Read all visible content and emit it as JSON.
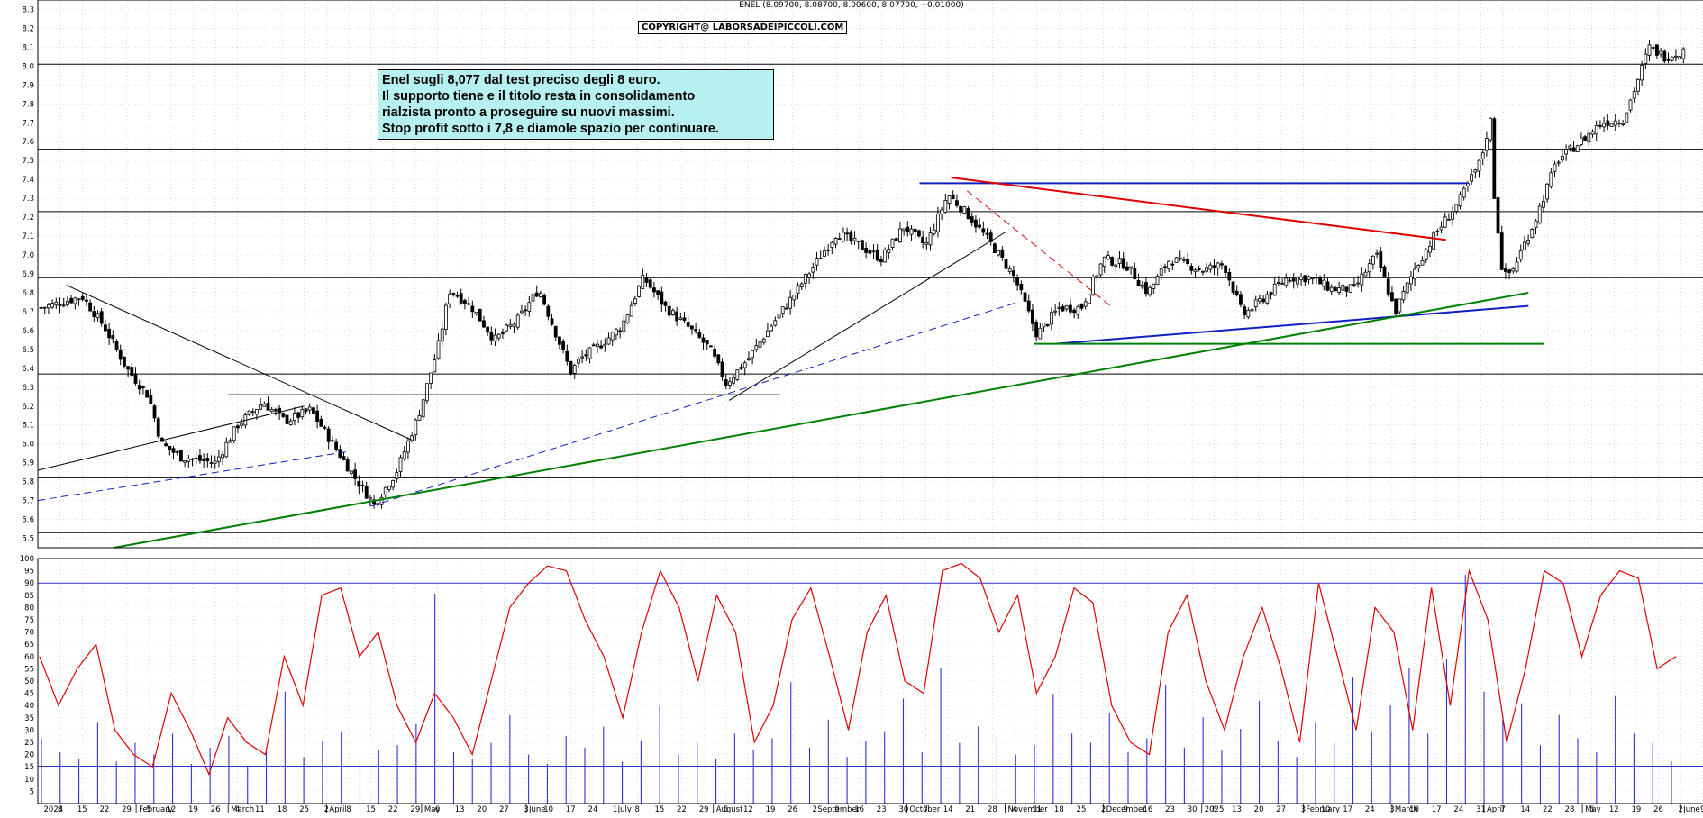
{
  "header": {
    "ohlc": "ENEL (8.09700, 8.08700, 8.00600, 8.07700, +0.01000)",
    "copyright": "COPYRIGHT@ LABORSADEIPICCOLI.COM"
  },
  "annotation": {
    "lines": [
      "Enel sugli 8,077 dal test preciso degli 8 euro.",
      "Il supporto tiene e il titolo resta in consolidamento",
      "rialzista pronto a proseguire su nuovi massimi.",
      "Stop profit sotto i 7,8 e diamole spazio per continuare."
    ]
  },
  "colors": {
    "candle": "#000000",
    "volume": "#3030d8",
    "stochastic": "#e00000",
    "support": "#008000",
    "trend_blue": "#1020c0",
    "resistance": "#e00000",
    "annotation_bg": "#b6f0f0"
  },
  "chart_data": [
    {
      "type": "candlestick",
      "title": "ENEL",
      "ylim": [
        5.45,
        8.35
      ],
      "y_ticks": [
        "5.5",
        "5.6",
        "5.7",
        "5.8",
        "5.9",
        "6.0",
        "6.1",
        "6.2",
        "6.3",
        "6.4",
        "6.5",
        "6.6",
        "6.7",
        "6.8",
        "6.9",
        "7.0",
        "7.1",
        "7.2",
        "7.3",
        "7.4",
        "7.5",
        "7.6",
        "7.7",
        "7.8",
        "7.9",
        "8.0",
        "8.1",
        "8.2",
        "8.3"
      ],
      "horizontal_levels": [
        5.53,
        5.82,
        6.37,
        6.88,
        7.23,
        7.56,
        8.01
      ],
      "close_path": [
        [
          "2024-01-02",
          6.72
        ],
        [
          "2024-01-15",
          6.78
        ],
        [
          "2024-01-22",
          6.62
        ],
        [
          "2024-01-29",
          6.4
        ],
        [
          "2024-02-05",
          6.25
        ],
        [
          "2024-02-09",
          6.0
        ],
        [
          "2024-02-15",
          5.93
        ],
        [
          "2024-02-26",
          5.9
        ],
        [
          "2024-03-04",
          6.1
        ],
        [
          "2024-03-12",
          6.22
        ],
        [
          "2024-03-19",
          6.12
        ],
        [
          "2024-03-27",
          6.18
        ],
        [
          "2024-04-03",
          6.0
        ],
        [
          "2024-04-10",
          5.82
        ],
        [
          "2024-04-16",
          5.68
        ],
        [
          "2024-04-23",
          5.85
        ],
        [
          "2024-04-30",
          6.15
        ],
        [
          "2024-05-06",
          6.5
        ],
        [
          "2024-05-10",
          6.82
        ],
        [
          "2024-05-17",
          6.72
        ],
        [
          "2024-05-24",
          6.55
        ],
        [
          "2024-05-31",
          6.65
        ],
        [
          "2024-06-07",
          6.82
        ],
        [
          "2024-06-12",
          6.6
        ],
        [
          "2024-06-17",
          6.38
        ],
        [
          "2024-06-20",
          6.45
        ],
        [
          "2024-06-26",
          6.52
        ],
        [
          "2024-07-03",
          6.62
        ],
        [
          "2024-07-10",
          6.88
        ],
        [
          "2024-07-17",
          6.72
        ],
        [
          "2024-07-24",
          6.62
        ],
        [
          "2024-07-31",
          6.5
        ],
        [
          "2024-08-05",
          6.32
        ],
        [
          "2024-08-12",
          6.45
        ],
        [
          "2024-08-19",
          6.62
        ],
        [
          "2024-08-26",
          6.78
        ],
        [
          "2024-09-02",
          6.95
        ],
        [
          "2024-09-09",
          7.12
        ],
        [
          "2024-09-16",
          7.05
        ],
        [
          "2024-09-23",
          6.98
        ],
        [
          "2024-09-30",
          7.15
        ],
        [
          "2024-10-07",
          7.05
        ],
        [
          "2024-10-14",
          7.32
        ],
        [
          "2024-10-21",
          7.2
        ],
        [
          "2024-10-28",
          7.05
        ],
        [
          "2024-11-04",
          6.88
        ],
        [
          "2024-11-11",
          6.58
        ],
        [
          "2024-11-18",
          6.72
        ],
        [
          "2024-11-25",
          6.72
        ],
        [
          "2024-12-02",
          6.98
        ],
        [
          "2024-12-09",
          6.95
        ],
        [
          "2024-12-16",
          6.8
        ],
        [
          "2024-12-23",
          6.98
        ],
        [
          "2025-01-02",
          6.92
        ],
        [
          "2025-01-09",
          6.95
        ],
        [
          "2025-01-15",
          6.68
        ],
        [
          "2025-01-22",
          6.78
        ],
        [
          "2025-01-29",
          6.88
        ],
        [
          "2025-02-05",
          6.88
        ],
        [
          "2025-02-12",
          6.82
        ],
        [
          "2025-02-19",
          6.82
        ],
        [
          "2025-02-26",
          7.0
        ],
        [
          "2025-03-04",
          6.7
        ],
        [
          "2025-03-10",
          6.92
        ],
        [
          "2025-03-17",
          7.12
        ],
        [
          "2025-03-24",
          7.28
        ],
        [
          "2025-03-31",
          7.5
        ],
        [
          "2025-04-03",
          7.72
        ],
        [
          "2025-04-04",
          7.35
        ],
        [
          "2025-04-07",
          6.88
        ],
        [
          "2025-04-10",
          6.92
        ],
        [
          "2025-04-17",
          7.18
        ],
        [
          "2025-04-24",
          7.5
        ],
        [
          "2025-04-30",
          7.58
        ],
        [
          "2025-05-08",
          7.7
        ],
        [
          "2025-05-15",
          7.72
        ],
        [
          "2025-05-20",
          7.95
        ],
        [
          "2025-05-23",
          8.1
        ],
        [
          "2025-05-28",
          8.05
        ],
        [
          "2025-06-03",
          8.08
        ]
      ],
      "trend_lines": [
        {
          "color": "black",
          "style": "solid",
          "from": [
            "2024-01-01",
            5.86
          ],
          "to": [
            "2024-03-25",
            6.2
          ]
        },
        {
          "color": "black",
          "style": "solid",
          "from": [
            "2024-01-10",
            6.84
          ],
          "to": [
            "2024-04-28",
            6.02
          ]
        },
        {
          "color": "black",
          "style": "solid",
          "from": [
            "2024-03-01",
            6.26
          ],
          "to": [
            "2024-08-22",
            6.26
          ]
        },
        {
          "color": "black",
          "style": "solid",
          "from": [
            "2024-08-06",
            6.23
          ],
          "to": [
            "2024-11-01",
            7.12
          ]
        },
        {
          "color": "blue",
          "style": "dashed",
          "from": [
            "2024-01-01",
            5.7
          ],
          "to": [
            "2024-04-08",
            5.96
          ]
        },
        {
          "color": "blue",
          "style": "dashed",
          "from": [
            "2024-04-15",
            5.67
          ],
          "to": [
            "2024-11-05",
            6.75
          ]
        },
        {
          "color": "blue",
          "style": "solid",
          "from": [
            "2024-10-05",
            7.38
          ],
          "to": [
            "2025-03-27",
            7.38
          ]
        },
        {
          "color": "blue",
          "style": "solid",
          "from": [
            "2024-11-17",
            6.53
          ],
          "to": [
            "2025-04-15",
            6.73
          ]
        },
        {
          "color": "red",
          "style": "solid",
          "from": [
            "2024-10-15",
            7.41
          ],
          "to": [
            "2025-03-20",
            7.08
          ]
        },
        {
          "color": "red",
          "style": "dashed",
          "from": [
            "2024-10-20",
            7.34
          ],
          "to": [
            "2024-12-05",
            6.72
          ]
        },
        {
          "color": "green",
          "style": "solid",
          "from": [
            "2024-01-25",
            5.45
          ],
          "to": [
            "2025-04-15",
            6.8
          ]
        },
        {
          "color": "green",
          "style": "solid",
          "from": [
            "2024-11-10",
            6.53
          ],
          "to": [
            "2025-04-20",
            6.53
          ]
        }
      ]
    },
    {
      "type": "line",
      "name": "stochastic oscillator",
      "ylim": [
        0,
        100
      ],
      "y_ticks": [
        "5",
        "10",
        "15",
        "20",
        "25",
        "30",
        "35",
        "40",
        "45",
        "50",
        "55",
        "60",
        "65",
        "70",
        "75",
        "80",
        "85",
        "90",
        "95",
        "100"
      ],
      "reference_level": 90,
      "values": [
        60,
        40,
        55,
        65,
        30,
        20,
        15,
        45,
        30,
        12,
        35,
        25,
        20,
        60,
        40,
        85,
        88,
        60,
        70,
        40,
        25,
        45,
        35,
        20,
        50,
        80,
        90,
        97,
        95,
        75,
        60,
        35,
        70,
        95,
        80,
        50,
        85,
        70,
        25,
        40,
        75,
        88,
        60,
        30,
        70,
        85,
        50,
        45,
        95,
        98,
        92,
        70,
        85,
        45,
        60,
        88,
        82,
        40,
        25,
        20,
        70,
        85,
        50,
        30,
        60,
        80,
        55,
        25,
        90,
        60,
        30,
        80,
        70,
        30,
        88,
        40,
        95,
        75,
        25,
        55,
        95,
        90,
        60,
        85,
        95,
        92,
        55,
        60
      ]
    },
    {
      "type": "bar",
      "name": "volume",
      "ylim": [
        0,
        10500
      ],
      "y_ticks": [
        "500",
        "1000",
        "1500",
        "2000",
        "2500",
        "3000",
        "3500",
        "4000",
        "4500",
        "5000",
        "5500",
        "6000",
        "6500",
        "7000",
        "7500",
        "8000",
        "8500",
        "9000",
        "9500",
        "10000",
        "10500"
      ],
      "scale_note": "x10000",
      "reference_level": 1600,
      "values": [
        2800,
        2200,
        1900,
        3500,
        1800,
        2600,
        2100,
        3000,
        1700,
        2400,
        2900,
        1600,
        2200,
        4800,
        2000,
        2700,
        3100,
        1800,
        2300,
        2500,
        3400,
        9000,
        2200,
        1900,
        2600,
        3800,
        2100,
        1700,
        2900,
        2400,
        3300,
        1800,
        2700,
        4200,
        2100,
        2600,
        1900,
        3000,
        2300,
        2800,
        5200,
        2400,
        3600,
        2000,
        2700,
        3100,
        4500,
        2200,
        5800,
        2600,
        3300,
        2900,
        2100,
        2500,
        4700,
        3000,
        2600,
        3900,
        2200,
        2800,
        5100,
        2400,
        3700,
        2300,
        3200,
        4400,
        2700,
        2000,
        3500,
        2600,
        5400,
        3100,
        4200,
        5800,
        3000,
        6200,
        9800,
        4800,
        3600,
        4300,
        2500,
        3800,
        2800,
        2200,
        4600,
        3000,
        2600,
        1800
      ]
    },
    {
      "type": "axis",
      "x_tick_labels": [
        "8",
        "15",
        "22",
        "29",
        "5",
        "12",
        "19",
        "26",
        "4",
        "11",
        "18",
        "25",
        "2",
        "8",
        "15",
        "22",
        "29",
        "6",
        "13",
        "20",
        "27",
        "3",
        "10",
        "17",
        "24",
        "1",
        "8",
        "15",
        "22",
        "29",
        "5",
        "12",
        "19",
        "26",
        "2",
        "9",
        "16",
        "23",
        "30",
        "7",
        "14",
        "21",
        "28",
        "4",
        "11",
        "18",
        "25",
        "2",
        "9",
        "16",
        "23",
        "30",
        "6",
        "13",
        "20",
        "27",
        "3",
        "10",
        "17",
        "24",
        "3",
        "10",
        "17",
        "24",
        "31",
        "7",
        "14",
        "22",
        "28",
        "5",
        "12",
        "19",
        "26",
        "2",
        "9",
        "16"
      ],
      "month_labels": [
        "2024",
        "February",
        "March",
        "April",
        "May",
        "June",
        "July",
        "August",
        "September",
        "October",
        "November",
        "December",
        "2025",
        "February",
        "March",
        "April",
        "May",
        "June"
      ]
    }
  ]
}
